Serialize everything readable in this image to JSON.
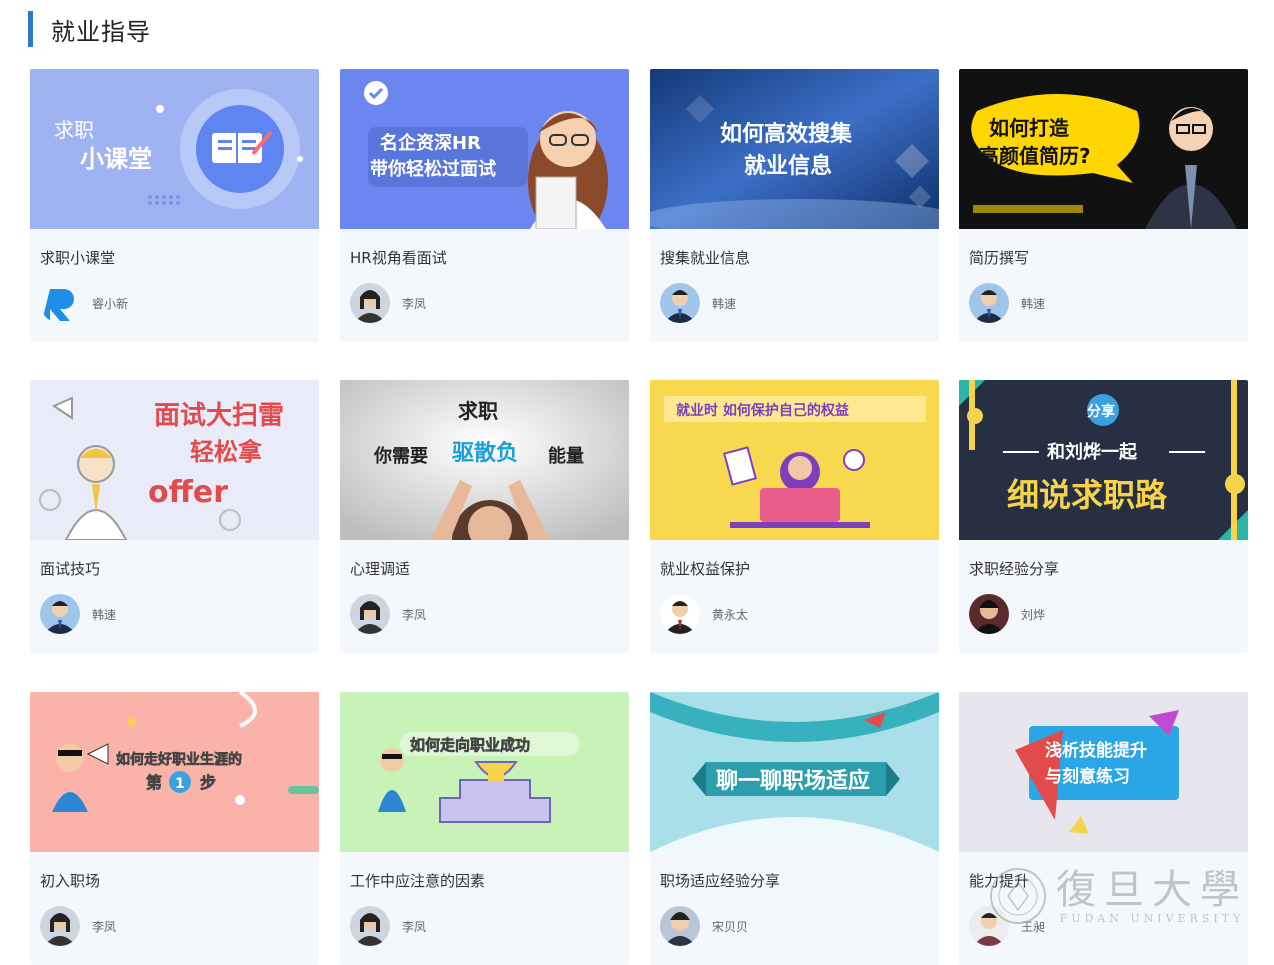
{
  "section": {
    "title": "就业指导"
  },
  "courses": [
    {
      "title": "求职小课堂",
      "author": "睿小新",
      "thumb_text": [
        "求职",
        "小课堂"
      ]
    },
    {
      "title": "HR视角看面试",
      "author": "李凤",
      "thumb_text": [
        "名企资深HR",
        "带你轻松过面试"
      ]
    },
    {
      "title": "搜集就业信息",
      "author": "韩速",
      "thumb_text": [
        "如何高效搜集",
        "就业信息"
      ]
    },
    {
      "title": "简历撰写",
      "author": "韩速",
      "thumb_text": [
        "如何打造",
        "高颜值简历?"
      ]
    },
    {
      "title": "面试技巧",
      "author": "韩速",
      "thumb_text": [
        "面试大扫雷",
        "轻松拿",
        "offer"
      ]
    },
    {
      "title": "心理调适",
      "author": "李凤",
      "thumb_text": [
        "求职",
        "你需要",
        "驱散负",
        "能量"
      ]
    },
    {
      "title": "就业权益保护",
      "author": "黄永太",
      "thumb_text": [
        "就业时 如何保护自己的权益"
      ]
    },
    {
      "title": "求职经验分享",
      "author": "刘烨",
      "thumb_text": [
        "分享",
        "和刘烨一起",
        "细说求职路"
      ]
    },
    {
      "title": "初入职场",
      "author": "李凤",
      "thumb_text": [
        "如何走好职业生涯的",
        "第",
        "1",
        "步"
      ]
    },
    {
      "title": "工作中应注意的因素",
      "author": "李凤",
      "thumb_text": [
        "如何走向职业成功"
      ]
    },
    {
      "title": "职场适应经验分享",
      "author": "宋贝贝",
      "thumb_text": [
        "聊一聊职场适应"
      ]
    },
    {
      "title": "能力提升",
      "author": "王昶",
      "thumb_text": [
        "浅析技能提升",
        "与刻意练习"
      ]
    }
  ],
  "watermark": {
    "cn": "復旦大學",
    "en": "FUDAN UNIVERSITY"
  },
  "colors": {
    "accent": "#2f78c9",
    "card_bg": "#f4f7fb"
  }
}
